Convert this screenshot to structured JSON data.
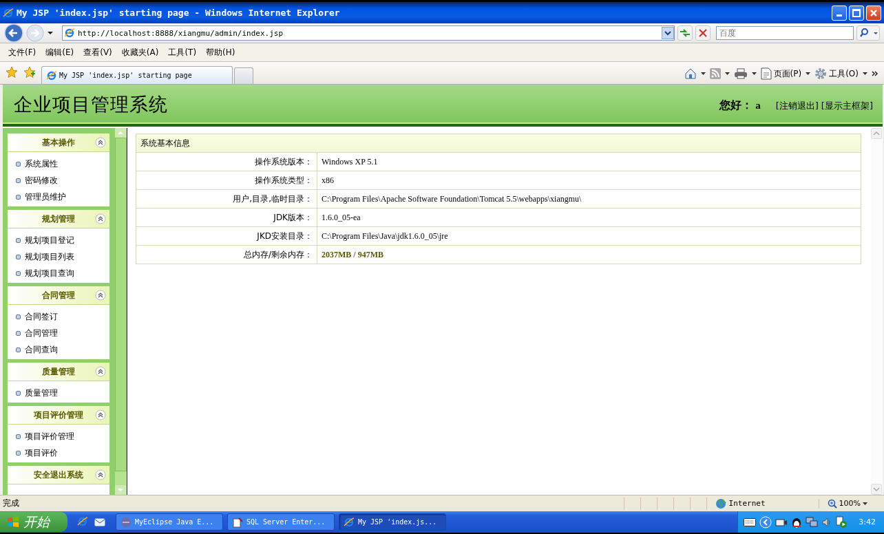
{
  "window": {
    "title": "My JSP 'index.jsp' starting page - Windows Internet Explorer"
  },
  "address_bar": {
    "url": "http://localhost:8888/xiangmu/admin/index.jsp"
  },
  "search": {
    "placeholder": "百度"
  },
  "menu": [
    "文件(F)",
    "编辑(E)",
    "查看(V)",
    "收藏夹(A)",
    "工具(T)",
    "帮助(H)"
  ],
  "tabs": [
    {
      "label": "My JSP 'index.jsp' starting page",
      "selected": true
    }
  ],
  "command_bar": [
    {
      "kind": "home"
    },
    {
      "kind": "feed"
    },
    {
      "kind": "print"
    },
    {
      "kind": "page",
      "label": "页面(P)"
    },
    {
      "kind": "tools",
      "label": "工具(O)"
    }
  ],
  "page": {
    "title": "企业项目管理系统",
    "greeting": "您好：",
    "user": "a",
    "links": [
      "[注销退出]",
      "[显示主框架]"
    ]
  },
  "sidebar": [
    {
      "title": "基本操作",
      "expanded": true,
      "items": [
        "系统属性",
        "密码修改",
        "管理员维护"
      ]
    },
    {
      "title": "规划管理",
      "expanded": true,
      "items": [
        "规划项目登记",
        "规划项目列表",
        "规划项目查询"
      ]
    },
    {
      "title": "合同管理",
      "expanded": true,
      "items": [
        "合同签订",
        "合同管理",
        "合同查询"
      ]
    },
    {
      "title": "质量管理",
      "expanded": true,
      "items": [
        "质量管理"
      ]
    },
    {
      "title": "项目评价管理",
      "expanded": true,
      "items": [
        "项目评价管理",
        "项目评价"
      ]
    },
    {
      "title": "安全退出系统",
      "expanded": true
    }
  ],
  "info_table": {
    "title": "系统基本信息",
    "rows": [
      {
        "label": "操作系统版本：",
        "value": "Windows XP  5.1"
      },
      {
        "label": "操作系统类型：",
        "value": "x86"
      },
      {
        "label": "用户,目录,临时目录：",
        "value": "C:\\Program Files\\Apache Software Foundation\\Tomcat 5.5\\webapps\\xiangmu\\"
      },
      {
        "label": "JDK版本：",
        "value": "1.6.0_05-ea"
      },
      {
        "label": "JKD安装目录：",
        "value": "C:\\Program Files\\Java\\jdk1.6.0_05\\jre"
      },
      {
        "label": "总内存/剩余内存：",
        "value": "**2037MB**  /  **947MB**"
      }
    ]
  },
  "status_bar": {
    "text": "完成",
    "zone": "Internet",
    "zoom": "100%"
  },
  "taskbar": {
    "start": "开始",
    "tasks": [
      {
        "label": "MyEclipse Java E...",
        "selected": false
      },
      {
        "label": "SQL Server Enter...",
        "selected": false
      },
      {
        "label": "My JSP 'index.js...",
        "selected": true
      }
    ],
    "clock": "3:42"
  }
}
